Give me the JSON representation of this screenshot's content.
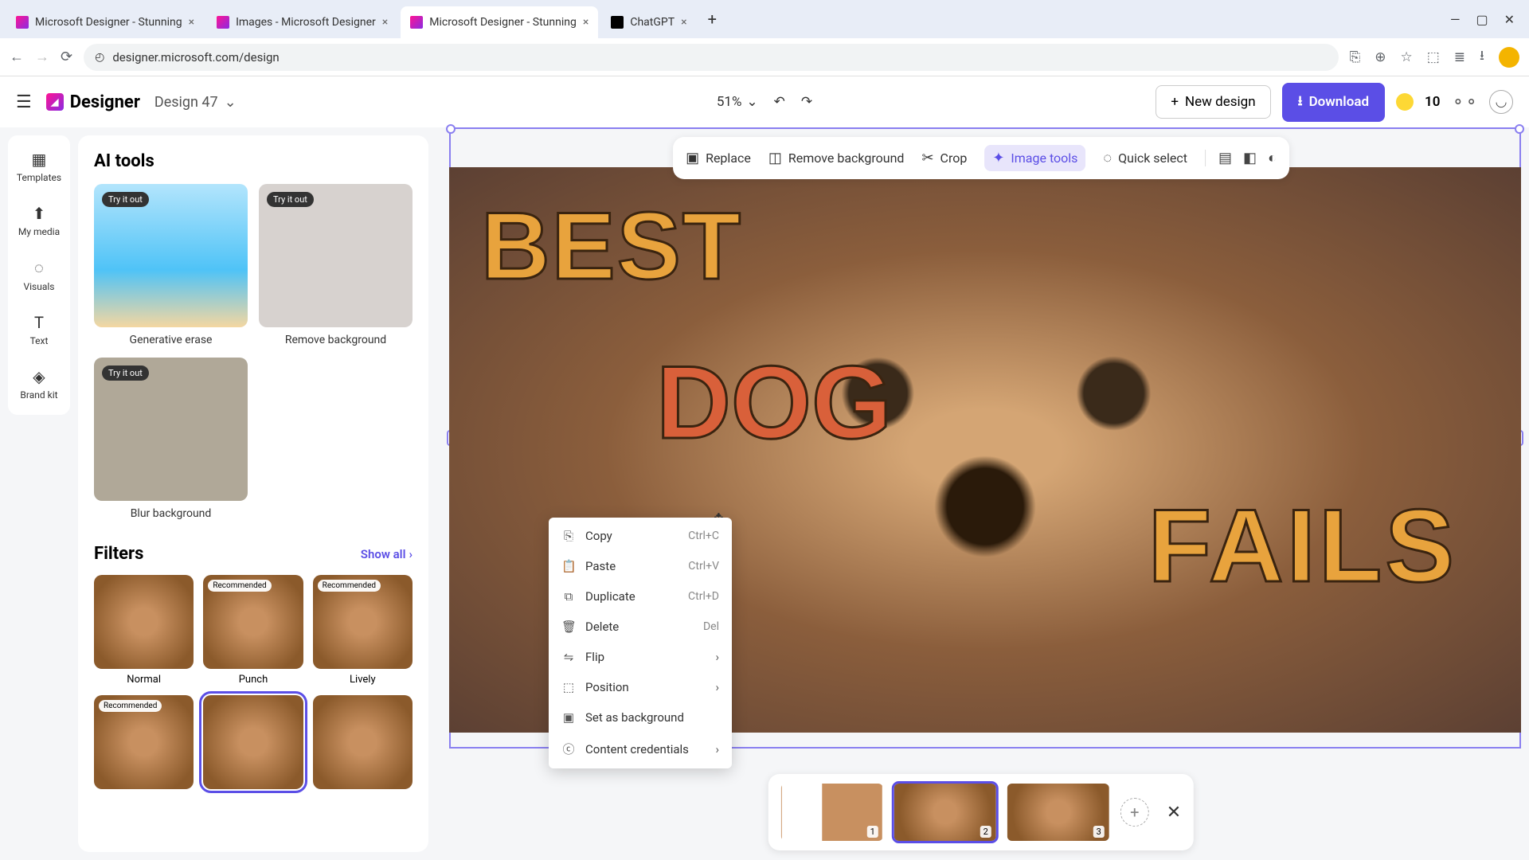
{
  "browser": {
    "tabs": [
      {
        "title": "Microsoft Designer - Stunning",
        "favicon": "d"
      },
      {
        "title": "Images - Microsoft Designer",
        "favicon": "d"
      },
      {
        "title": "Microsoft Designer - Stunning",
        "favicon": "d",
        "active": true
      },
      {
        "title": "ChatGPT",
        "favicon": "c"
      }
    ],
    "url": "designer.microsoft.com/design"
  },
  "header": {
    "brand": "Designer",
    "design_name": "Design 47",
    "zoom": "51%",
    "new_design": "New design",
    "download": "Download",
    "credits": "10"
  },
  "rail": [
    "Templates",
    "My media",
    "Visuals",
    "Text",
    "Brand kit"
  ],
  "rail_icons": [
    "▦",
    "⬆",
    "◌",
    "T",
    "◈"
  ],
  "panel": {
    "ai_title": "AI tools",
    "try_pill": "Try it out",
    "tools": [
      "Generative erase",
      "Remove background",
      "Blur background"
    ],
    "filters_title": "Filters",
    "show_all": "Show all",
    "filters": [
      "Normal",
      "Punch",
      "Lively"
    ],
    "recommended": "Recommended"
  },
  "toolbar": {
    "replace": "Replace",
    "remove_bg": "Remove background",
    "crop": "Crop",
    "image_tools": "Image tools",
    "quick_select": "Quick select"
  },
  "canvas_text": {
    "best": "BEST",
    "dog": "DOG",
    "fails": "FAILS"
  },
  "context_menu": {
    "copy": {
      "label": "Copy",
      "shortcut": "Ctrl+C"
    },
    "paste": {
      "label": "Paste",
      "shortcut": "Ctrl+V"
    },
    "duplicate": {
      "label": "Duplicate",
      "shortcut": "Ctrl+D"
    },
    "delete": {
      "label": "Delete",
      "shortcut": "Del"
    },
    "flip": {
      "label": "Flip"
    },
    "position": {
      "label": "Position"
    },
    "set_bg": {
      "label": "Set as background"
    },
    "credentials": {
      "label": "Content credentials"
    }
  },
  "pages": {
    "count": 3,
    "active": 2
  }
}
